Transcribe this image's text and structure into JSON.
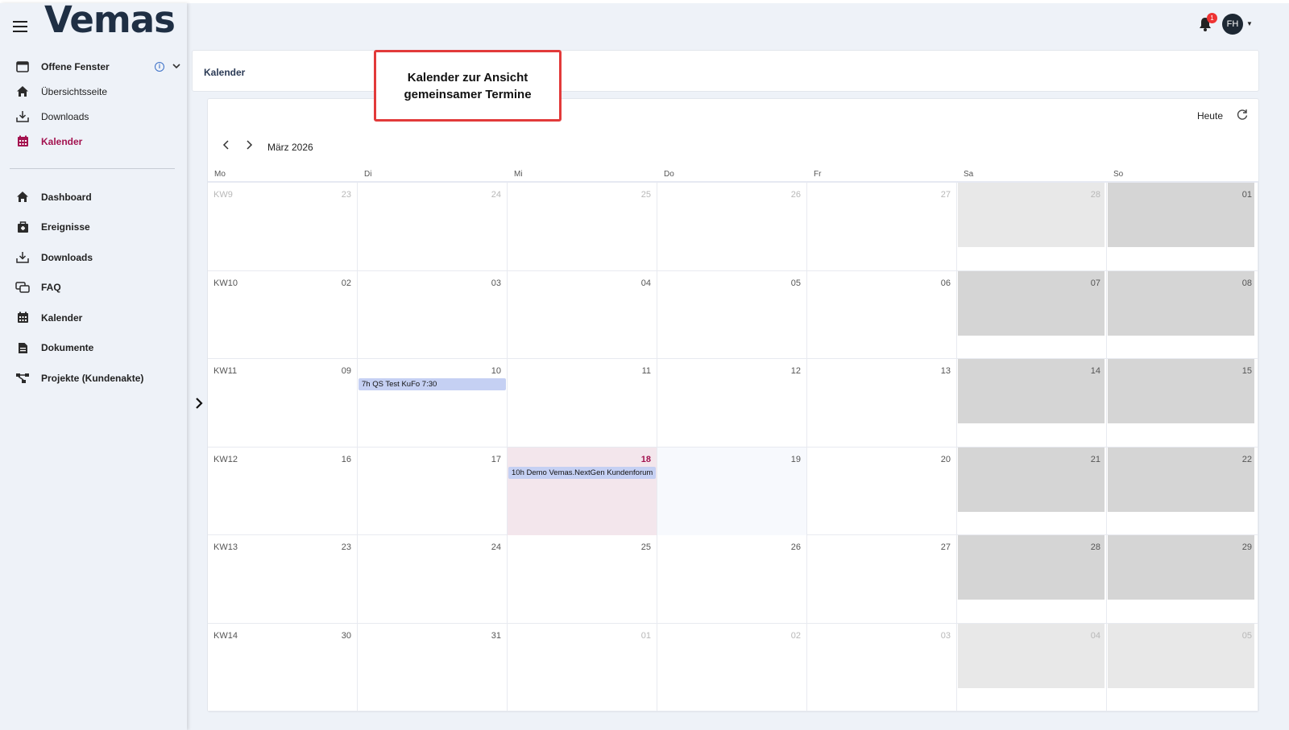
{
  "app": {
    "logo": "Vemas"
  },
  "sidebar": {
    "open_windows": {
      "label": "Offene Fenster",
      "info": "i"
    },
    "top_items": [
      {
        "label": "Übersichtsseite",
        "icon": "home-icon"
      },
      {
        "label": "Downloads",
        "icon": "download-icon"
      },
      {
        "label": "Kalender",
        "icon": "calendar-icon",
        "active": true
      }
    ],
    "main_items": [
      {
        "label": "Dashboard",
        "icon": "home-icon"
      },
      {
        "label": "Ereignisse",
        "icon": "briefcase-icon"
      },
      {
        "label": "Downloads",
        "icon": "download-icon"
      },
      {
        "label": "FAQ",
        "icon": "chat-icon"
      },
      {
        "label": "Kalender",
        "icon": "calendar-icon"
      },
      {
        "label": "Dokumente",
        "icon": "document-icon"
      },
      {
        "label": "Projekte (Kundenakte)",
        "icon": "project-icon"
      }
    ]
  },
  "header": {
    "notifications": "1",
    "avatar_initials": "FH"
  },
  "breadcrumb": {
    "title": "Kalender"
  },
  "callout": {
    "text": "Kalender zur Ansicht gemeinsamer Termine"
  },
  "calendar": {
    "today_label": "Heute",
    "month_label": "März 2026",
    "weekdays": [
      "Mo",
      "Di",
      "Mi",
      "Do",
      "Fr",
      "Sa",
      "So"
    ],
    "weeks": [
      {
        "kw": "KW9",
        "days": [
          "23",
          "24",
          "25",
          "26",
          "27",
          "28",
          "01"
        ],
        "dim": [
          true,
          true,
          true,
          true,
          true,
          true,
          false
        ]
      },
      {
        "kw": "KW10",
        "days": [
          "02",
          "03",
          "04",
          "05",
          "06",
          "07",
          "08"
        ],
        "dim": [
          false,
          false,
          false,
          false,
          false,
          false,
          false
        ]
      },
      {
        "kw": "KW11",
        "days": [
          "09",
          "10",
          "11",
          "12",
          "13",
          "14",
          "15"
        ],
        "dim": [
          false,
          false,
          false,
          false,
          false,
          false,
          false
        ]
      },
      {
        "kw": "KW12",
        "days": [
          "16",
          "17",
          "18",
          "19",
          "20",
          "21",
          "22"
        ],
        "dim": [
          false,
          false,
          false,
          false,
          false,
          false,
          false
        ]
      },
      {
        "kw": "KW13",
        "days": [
          "23",
          "24",
          "25",
          "26",
          "27",
          "28",
          "29"
        ],
        "dim": [
          false,
          false,
          false,
          false,
          false,
          false,
          false
        ]
      },
      {
        "kw": "KW14",
        "days": [
          "30",
          "31",
          "01",
          "02",
          "03",
          "04",
          "05"
        ],
        "dim": [
          false,
          false,
          true,
          true,
          true,
          true,
          true
        ]
      }
    ],
    "events": [
      {
        "week": 2,
        "day": 1,
        "label": "7h QS Test KuFo 7:30"
      },
      {
        "week": 3,
        "day": 2,
        "label": "10h Demo Vemas.NextGen Kundenforum"
      }
    ],
    "today": {
      "week": 3,
      "day": 2
    },
    "colors": {
      "accent": "#a3124f",
      "event": "#c5d0f3",
      "weekend": "#d5d5d5"
    }
  }
}
